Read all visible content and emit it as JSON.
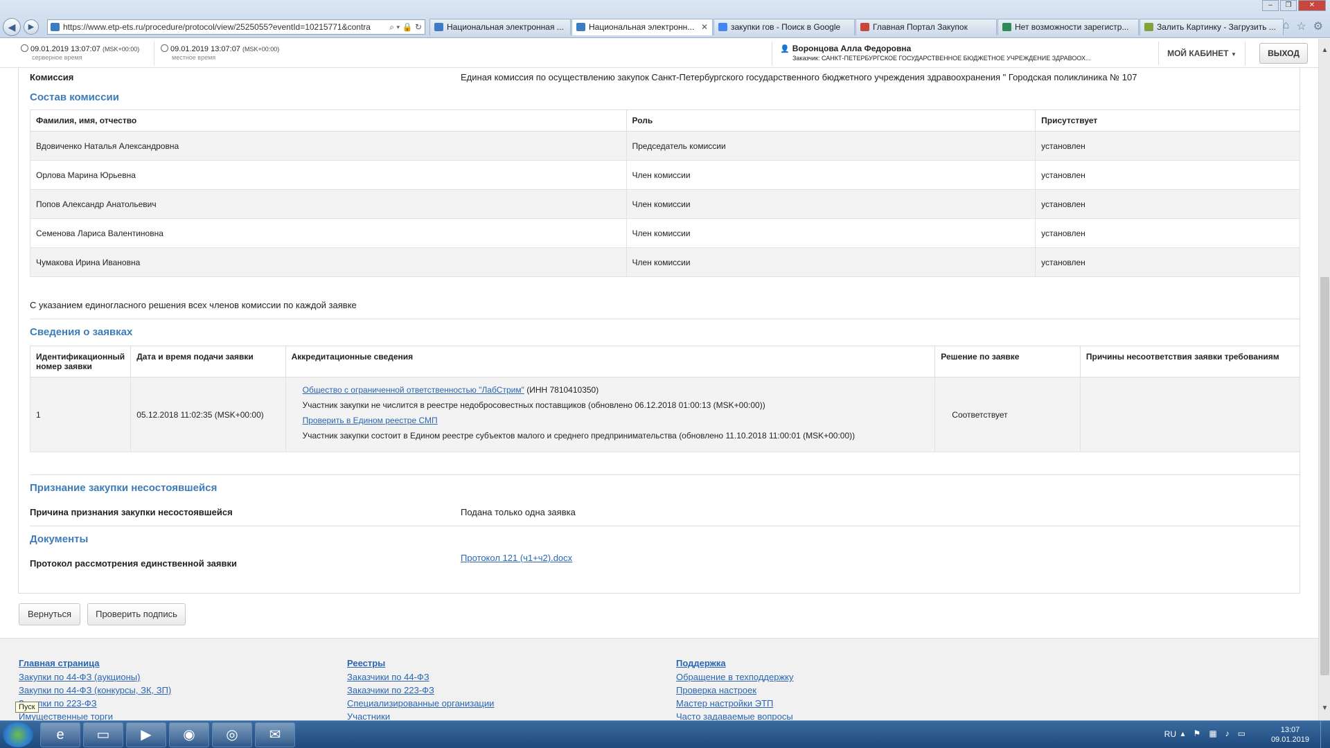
{
  "browser": {
    "url": "https://www.etp-ets.ru/procedure/protocol/view/2525055?eventId=10215771&contra",
    "tabs": [
      {
        "label": "Национальная электронная ...",
        "color": "#3b7cc4",
        "active": false
      },
      {
        "label": "Национальная электронн...",
        "color": "#3b7cc4",
        "active": true
      },
      {
        "label": "закупки гов - Поиск в Google",
        "color": "#4285f4",
        "active": false
      },
      {
        "label": "Главная Портал Закупок",
        "color": "#c9463d",
        "active": false
      },
      {
        "label": "Нет возможности зарегистр...",
        "color": "#2e8b57",
        "active": false
      },
      {
        "label": "Залить Картинку - Загрузить ...",
        "color": "#7fa33a",
        "active": false
      }
    ]
  },
  "header": {
    "server_time": "09.01.2019 13:07:07",
    "server_tz": "(MSK+00:00)",
    "server_label": "серверное время",
    "local_time": "09.01.2019 13:07:07",
    "local_tz": "(MSK+00:00)",
    "local_label": "местное время",
    "user_name": "Воронцова Алла Федоровна",
    "user_org": "Заказчик: САНКТ-ПЕТЕРБУРГСКОЕ ГОСУДАРСТВЕННОЕ БЮДЖЕТНОЕ УЧРЕЖДЕНИЕ ЗДРАВООХ...",
    "cabinet_label": "МОЙ КАБИНЕТ",
    "logout_label": "ВЫХОД"
  },
  "commission": {
    "label": "Комиссия",
    "value": "Единая комиссия по осуществлению закупок Санкт-Петербургского государственного бюджетного учреждения здравоохранения \" Городская поликлиника № 107",
    "section_title": "Состав комиссии",
    "columns": [
      "Фамилия, имя, отчество",
      "Роль",
      "Присутствует"
    ],
    "members": [
      {
        "name": "Вдовиченко Наталья Александровна",
        "role": "Председатель комиссии",
        "present": "установлен"
      },
      {
        "name": "Орлова Марина Юрьевна",
        "role": "Член комиссии",
        "present": "установлен"
      },
      {
        "name": "Попов Александр Анатольевич",
        "role": "Член комиссии",
        "present": "установлен"
      },
      {
        "name": "Семенова Лариса Валентиновна",
        "role": "Член комиссии",
        "present": "установлен"
      },
      {
        "name": "Чумакова Ирина Ивановна",
        "role": "Член комиссии",
        "present": "установлен"
      }
    ],
    "note": "С указанием единогласного решения всех членов комиссии по каждой заявке"
  },
  "applications": {
    "section_title": "Сведения о заявках",
    "columns": [
      "Идентификационный номер заявки",
      "Дата и время подачи заявки",
      "Аккредитационные сведения",
      "Решение по заявке",
      "Причины несоответствия заявки требованиям"
    ],
    "rows": [
      {
        "id": "1",
        "date": "05.12.2018 11:02:35 (MSK+00:00)",
        "org_link": "Общество с ограниченной ответственностью \"ЛабСтрим\"",
        "inn": "(ИНН 7810410350)",
        "line2": "Участник закупки не числится в реестре недобросовестных поставщиков (обновлено 06.12.2018 01:00:13 (MSK+00:00))",
        "smp_link": "Проверить в Едином реестре СМП",
        "line4": "Участник закупки состоит в Едином реестре субъектов малого и среднего предпринимательства (обновлено 11.10.2018 11:00:01 (MSK+00:00))",
        "decision": "Соответствует",
        "reasons": ""
      }
    ]
  },
  "failure": {
    "section_title": "Признание закупки несостоявшейся",
    "label": "Причина признания закупки несостоявшейся",
    "value": "Подана только одна заявка"
  },
  "documents": {
    "section_title": "Документы",
    "label": "Протокол рассмотрения единственной заявки",
    "link": "Протокол 121 (ч1+ч2).docx"
  },
  "buttons": {
    "back": "Вернуться",
    "check_signature": "Проверить подпись"
  },
  "footer": {
    "columns": [
      {
        "title": "Главная страница",
        "links": [
          "Закупки по 44-ФЗ (аукционы)",
          "Закупки по 44-ФЗ (конкурсы, ЗК, ЗП)",
          "Закупки по 223-ФЗ",
          "Имущественные торги"
        ]
      },
      {
        "title": "Реестры",
        "links": [
          "Заказчики по 44-ФЗ",
          "Заказчики по 223-ФЗ",
          "Специализированные организации",
          "Участники"
        ]
      },
      {
        "title": "Поддержка",
        "links": [
          "Обращение в техподдержку",
          "Проверка настроек",
          "Мастер настройки ЭТП",
          "Часто задаваемые вопросы"
        ]
      }
    ],
    "tooltip": "Пуск"
  },
  "taskbar": {
    "lang": "RU",
    "time": "13:07",
    "date": "09.01.2019"
  }
}
